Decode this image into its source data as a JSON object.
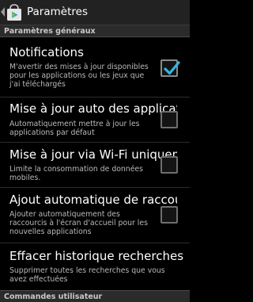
{
  "header": {
    "title": "Paramètres",
    "app_icon": "play-store-bag-icon",
    "back": "back-chevron-icon"
  },
  "sections": {
    "general": "Paramètres généraux",
    "user": "Commandes utilisateur"
  },
  "preferences": [
    {
      "title": "Notifications",
      "summary": "M'avertir des mises à jour disponibles pour les applications ou les jeux que j'ai téléchargés",
      "checked": true
    },
    {
      "title": "Mise à jour auto des applications",
      "summary": "Automatiquement mettre à jour les applications par défaut",
      "checked": false
    },
    {
      "title": "Mise à jour via Wi-Fi uniquement",
      "summary": "Limite la consommation de données mobiles.",
      "checked": false
    },
    {
      "title": "Ajout automatique de raccourcis",
      "summary": "Ajouter automatiquement des raccourcis à l'écran d'accueil pour les nouvelles applications",
      "checked": false
    },
    {
      "title": "Effacer historique recherches",
      "summary": "Supprimer toutes les recherches que vous avez effectuées"
    }
  ],
  "colors": {
    "checkmark": "#33b5e5",
    "background": "#000000",
    "section_header": "#2b2b2b"
  }
}
